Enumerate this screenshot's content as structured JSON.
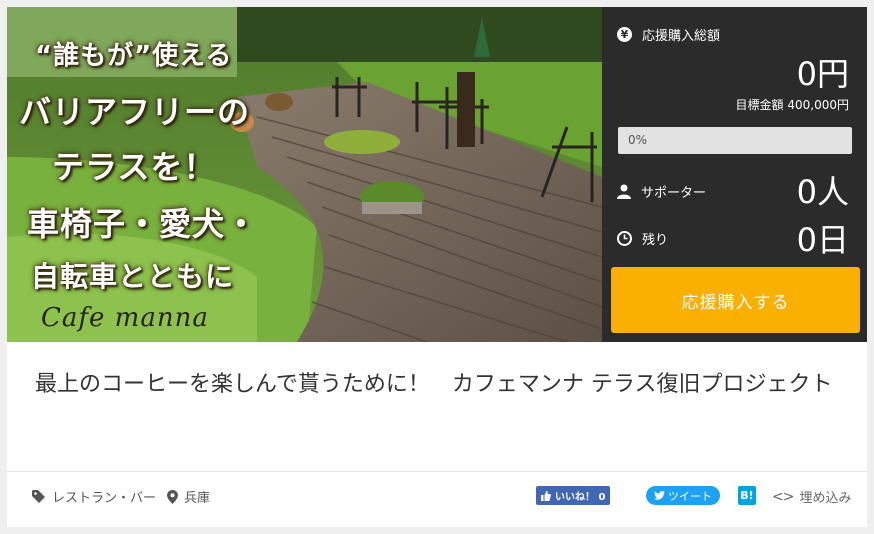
{
  "hero": {
    "lines": [
      "“誰もが”使える",
      "バリアフリーの",
      "テラスを！",
      "車椅子・愛犬・",
      "自転車とともに"
    ],
    "brand": "Cafe manna"
  },
  "panel": {
    "total_label": "応援購入総額",
    "total_value": "0円",
    "goal_text": "目標金額 400,000円",
    "progress_text": "0%",
    "progress_fraction": 0,
    "supporters_label": "サポーター",
    "supporters_value": "0人",
    "remaining_label": "残り",
    "remaining_value": "0日",
    "cta_label": "応援購入する",
    "accent_color": "#f9b000"
  },
  "project": {
    "title": "最上のコーヒーを楽しんで貰うために！　カフェマンナ テラス復旧プロジェクト"
  },
  "meta": {
    "category": "レストラン・バー",
    "location": "兵庫",
    "fb_label": "いいね！ 0",
    "tweet_label": "ツイート",
    "hatena_label": "B!",
    "embed_label": "埋め込み"
  },
  "icons": [
    "yen-icon",
    "person-icon",
    "clock-icon",
    "tag-icon",
    "location-pin-icon",
    "thumbs-up-icon",
    "twitter-bird-icon",
    "code-icon"
  ]
}
